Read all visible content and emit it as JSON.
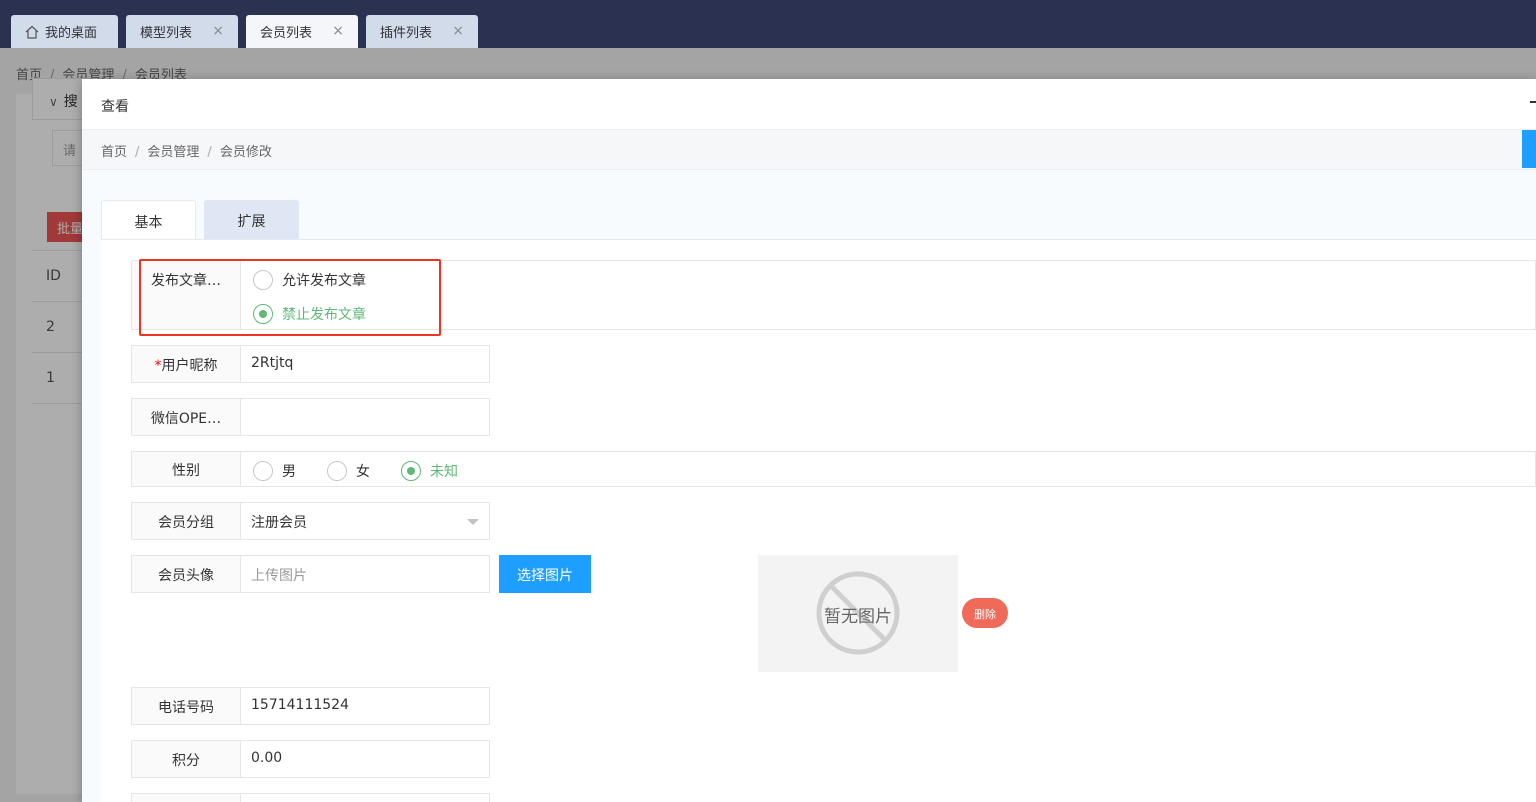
{
  "top_tabs": [
    {
      "label": "我的桌面",
      "closable": false
    },
    {
      "label": "模型列表",
      "closable": true
    },
    {
      "label": "会员列表",
      "closable": true,
      "active": true
    },
    {
      "label": "插件列表",
      "closable": true
    }
  ],
  "close_glyph": "×",
  "background": {
    "breadcrumb": [
      "首页",
      "会员管理",
      "会员列表"
    ],
    "search_head": "搜",
    "search_placeholder": "请",
    "batch_button": "批量",
    "table_header": "ID",
    "rows": [
      "2",
      "1"
    ]
  },
  "modal": {
    "title": "查看",
    "breadcrumb": [
      "首页",
      "会员管理",
      "会员修改"
    ],
    "tabs": [
      "基本",
      "扩展"
    ],
    "form": {
      "publish": {
        "label": "发布文章…",
        "options": [
          "允许发布文章",
          "禁止发布文章"
        ],
        "selected": "禁止发布文章"
      },
      "nickname": {
        "label": "用户昵称",
        "required_mark": "*",
        "value": "2Rtjtq"
      },
      "openid": {
        "label": "微信OPE…",
        "value": ""
      },
      "gender": {
        "label": "性别",
        "options": [
          "男",
          "女",
          "未知"
        ],
        "selected": "未知"
      },
      "group": {
        "label": "会员分组",
        "value": "注册会员"
      },
      "avatar": {
        "label": "会员头像",
        "placeholder": "上传图片",
        "choose_button": "选择图片",
        "no_image_text": "暂无图片",
        "delete_button": "删除"
      },
      "phone": {
        "label": "电话号码",
        "value": "15714111524"
      },
      "points": {
        "label": "积分",
        "value": "0.00"
      }
    }
  },
  "colors": {
    "topbar": "#2b3150",
    "accent_blue": "#1e9fff",
    "radio_green": "#5fb878",
    "delete_red": "#f06a5a",
    "highlight_red": "#e33322"
  }
}
